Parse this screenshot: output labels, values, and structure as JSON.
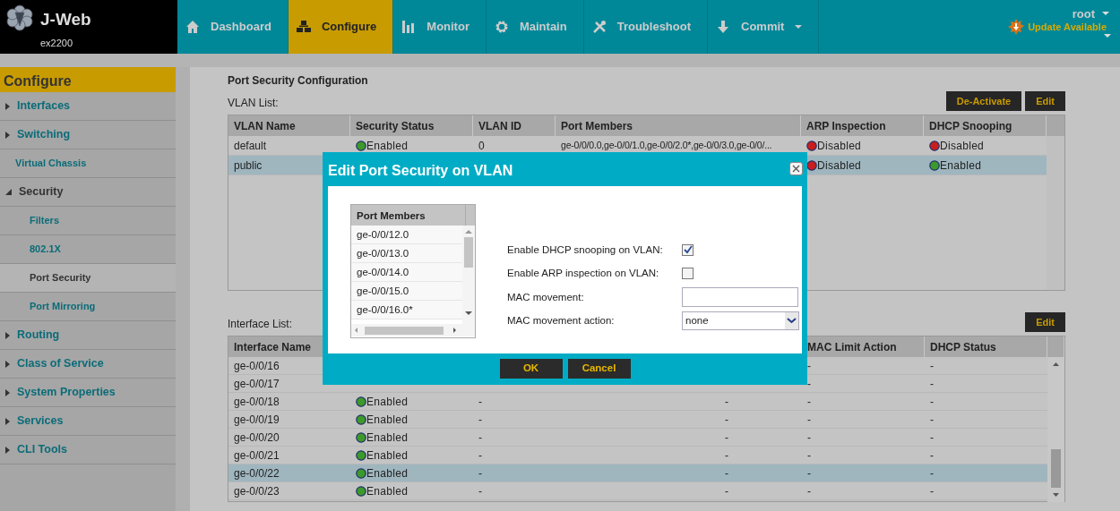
{
  "header": {
    "app_name": "J-Web",
    "device": "ex2200",
    "user": "root",
    "update": "Update Available"
  },
  "nav": [
    {
      "label": "Dashboard",
      "selected": false,
      "dropdown": false
    },
    {
      "label": "Configure",
      "selected": true,
      "dropdown": false
    },
    {
      "label": "Monitor",
      "selected": false,
      "dropdown": false
    },
    {
      "label": "Maintain",
      "selected": false,
      "dropdown": false
    },
    {
      "label": "Troubleshoot",
      "selected": false,
      "dropdown": false
    },
    {
      "label": "Commit",
      "selected": false,
      "dropdown": true
    }
  ],
  "sidebar": {
    "title": "Configure",
    "items": [
      {
        "label": "Interfaces",
        "kind": "group",
        "expanded": false,
        "selected": false
      },
      {
        "label": "Switching",
        "kind": "group",
        "expanded": false,
        "selected": false
      },
      {
        "label": "Virtual Chassis",
        "kind": "link",
        "selected": false
      },
      {
        "label": "Security",
        "kind": "group",
        "expanded": true,
        "selected": false,
        "children": [
          {
            "label": "Filters",
            "selected": false
          },
          {
            "label": "802.1X",
            "selected": false
          },
          {
            "label": "Port Security",
            "selected": true
          },
          {
            "label": "Port Mirroring",
            "selected": false
          }
        ]
      },
      {
        "label": "Routing",
        "kind": "group",
        "expanded": false,
        "selected": false
      },
      {
        "label": "Class of Service",
        "kind": "group",
        "expanded": false,
        "selected": false
      },
      {
        "label": "System Properties",
        "kind": "group",
        "expanded": false,
        "selected": false
      },
      {
        "label": "Services",
        "kind": "group",
        "expanded": false,
        "selected": false
      },
      {
        "label": "CLI Tools",
        "kind": "group",
        "expanded": false,
        "selected": false
      }
    ]
  },
  "page_title": "Port Security Configuration",
  "vlan_list": {
    "label": "VLAN List:",
    "buttons": [
      "De-Activate",
      "Edit"
    ],
    "columns": [
      "VLAN Name",
      "Security Status",
      "VLAN ID",
      "Port Members",
      "ARP Inspection",
      "DHCP Snooping"
    ],
    "rows": [
      {
        "selected": false,
        "name": "default",
        "security_status": {
          "text": "Enabled",
          "on": true
        },
        "vlan_id": "0",
        "port_members": "ge-0/0/0.0,ge-0/0/1.0,ge-0/0/2.0*,ge-0/0/3.0,ge-0/0/...",
        "arp_inspection": {
          "text": "Disabled",
          "on": false
        },
        "dhcp_snooping": {
          "text": "Disabled",
          "on": false
        }
      },
      {
        "selected": true,
        "name": "public",
        "arp_inspection": {
          "text": "Disabled",
          "on": false
        },
        "dhcp_snooping": {
          "text": "Enabled",
          "on": true
        }
      }
    ]
  },
  "interface_list": {
    "label": "Interface List:",
    "buttons": [
      "Edit"
    ],
    "columns": {
      "interface_name": "Interface Name",
      "mac_limit_action": "MAC Limit Action",
      "dhcp_status": "DHCP Status"
    },
    "rows": [
      {
        "selected": false,
        "name": "ge-0/0/16",
        "mac_limit_action": "-",
        "dhcp_status": "-"
      },
      {
        "selected": false,
        "name": "ge-0/0/17",
        "mac_limit_action": "-",
        "dhcp_status": "-"
      },
      {
        "selected": false,
        "name": "ge-0/0/18",
        "status": {
          "text": "Enabled",
          "on": true
        },
        "column_3": "-",
        "column_4": "-",
        "mac_limit_action": "-",
        "dhcp_status": "-"
      },
      {
        "selected": false,
        "name": "ge-0/0/19",
        "status": {
          "text": "Enabled",
          "on": true
        },
        "column_3": "-",
        "column_4": "-",
        "mac_limit_action": "-",
        "dhcp_status": "-"
      },
      {
        "selected": false,
        "name": "ge-0/0/20",
        "status": {
          "text": "Enabled",
          "on": true
        },
        "column_3": "-",
        "column_4": "-",
        "mac_limit_action": "-",
        "dhcp_status": "-"
      },
      {
        "selected": false,
        "name": "ge-0/0/21",
        "status": {
          "text": "Enabled",
          "on": true
        },
        "column_3": "-",
        "column_4": "-",
        "mac_limit_action": "-",
        "dhcp_status": "-"
      },
      {
        "selected": true,
        "name": "ge-0/0/22",
        "status": {
          "text": "Enabled",
          "on": true
        },
        "column_3": "-",
        "column_4": "-",
        "mac_limit_action": "-",
        "dhcp_status": "-"
      },
      {
        "selected": false,
        "name": "ge-0/0/23",
        "status": {
          "text": "Enabled",
          "on": true
        },
        "column_3": "-",
        "column_4": "-",
        "mac_limit_action": "-",
        "dhcp_status": "-"
      }
    ]
  },
  "dialog": {
    "title": "Edit Port Security on VLAN",
    "port_members": {
      "heading": "Port Members",
      "items": [
        "ge-0/0/12.0",
        "ge-0/0/13.0",
        "ge-0/0/14.0",
        "ge-0/0/15.0",
        "ge-0/0/16.0*"
      ]
    },
    "fields": [
      {
        "kind": "checkbox",
        "label": "Enable DHCP snooping on VLAN:",
        "checked": true
      },
      {
        "kind": "checkbox",
        "label": "Enable ARP inspection on VLAN:",
        "checked": false
      },
      {
        "kind": "text",
        "label": "MAC movement:"
      },
      {
        "kind": "select",
        "label": "MAC movement action:",
        "value": "none"
      }
    ],
    "buttons": [
      "OK",
      "Cancel"
    ]
  }
}
